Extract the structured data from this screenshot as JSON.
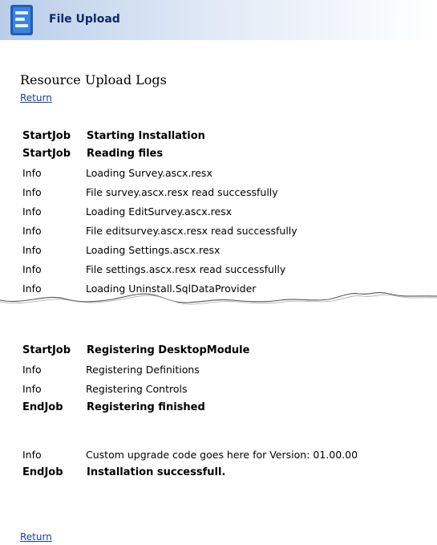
{
  "header": {
    "title": "File Upload",
    "icon": "module-icon",
    "colors": {
      "title": "#0b2a66",
      "bar_start": "#b9cde9",
      "bar_end": "#ffffff"
    }
  },
  "section_title": "Resource Upload Logs",
  "links": {
    "return_top": "Return",
    "return_bottom": "Return"
  },
  "logs_before_break": [
    {
      "type": "StartJob",
      "message": "Starting Installation",
      "bold": true
    },
    {
      "type": "StartJob",
      "message": "Reading files",
      "bold": true
    },
    {
      "type": "Info",
      "message": "Loading Survey.ascx.resx",
      "bold": false
    },
    {
      "type": "Info",
      "message": "File survey.ascx.resx read successfully",
      "bold": false
    },
    {
      "type": "Info",
      "message": "Loading EditSurvey.ascx.resx",
      "bold": false
    },
    {
      "type": "Info",
      "message": "File editsurvey.ascx.resx read successfully",
      "bold": false
    },
    {
      "type": "Info",
      "message": "Loading Settings.ascx.resx",
      "bold": false
    },
    {
      "type": "Info",
      "message": "File settings.ascx.resx read successfully",
      "bold": false
    },
    {
      "type": "Info",
      "message": "Loading Uninstall.SqlDataProvider",
      "bold": false
    }
  ],
  "logs_after_break": [
    {
      "type": "StartJob",
      "message": "Registering DesktopModule",
      "bold": true
    },
    {
      "type": "Info",
      "message": "Registering Definitions",
      "bold": false
    },
    {
      "type": "Info",
      "message": "Registering Controls",
      "bold": false
    },
    {
      "type": "EndJob",
      "message": "Registering finished",
      "bold": true
    },
    {
      "type": "Info",
      "message": "Custom upgrade code goes here for Version: 01.00.00",
      "bold": false
    },
    {
      "type": "EndJob",
      "message": "Installation successfull.",
      "bold": true
    }
  ]
}
